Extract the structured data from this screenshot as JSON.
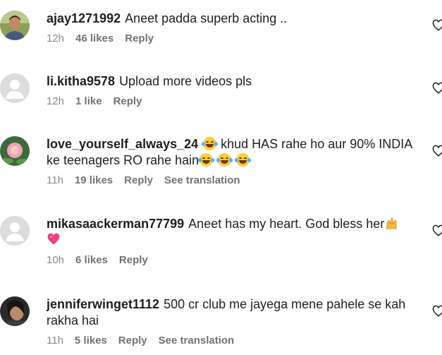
{
  "comments": [
    {
      "username": "ajay1271992",
      "text": "Aneet padda superb acting ..",
      "time": "12h",
      "likes": "46 likes",
      "reply": "Reply"
    },
    {
      "username": "li.kitha9578",
      "text": "Upload more videos pls",
      "time": "12h",
      "likes": "1 like",
      "reply": "Reply"
    },
    {
      "username": "love_yourself_always_24",
      "text1": " khud HAS rahe ho aur 90% INDIA ke teenagers RO rahe hain",
      "time": "11h",
      "likes": "19 likes",
      "reply": "Reply",
      "translate": "See translation"
    },
    {
      "username": "mikasaackerman77799",
      "text": "Aneet has my heart. God bless her",
      "time": "10h",
      "likes": "6 likes",
      "reply": "Reply"
    },
    {
      "username": "jenniferwinget1112",
      "text": "500 cr club me jayega mene pahele se kah rakha hai",
      "time": "11h",
      "likes": "5 likes",
      "reply": "Reply",
      "translate": "See translation"
    }
  ],
  "icons": {
    "like": "heart-outline-icon",
    "default_avatar": "default-avatar-icon",
    "laugh_emoji": "tears-of-joy-emoji",
    "pink_heart": "pink-heart-emoji",
    "raised_hands": "raised-hands-emoji"
  },
  "colors": {
    "text": "#1f1f1f",
    "meta": "#737373",
    "avatar_default": "#dcdcdc"
  }
}
